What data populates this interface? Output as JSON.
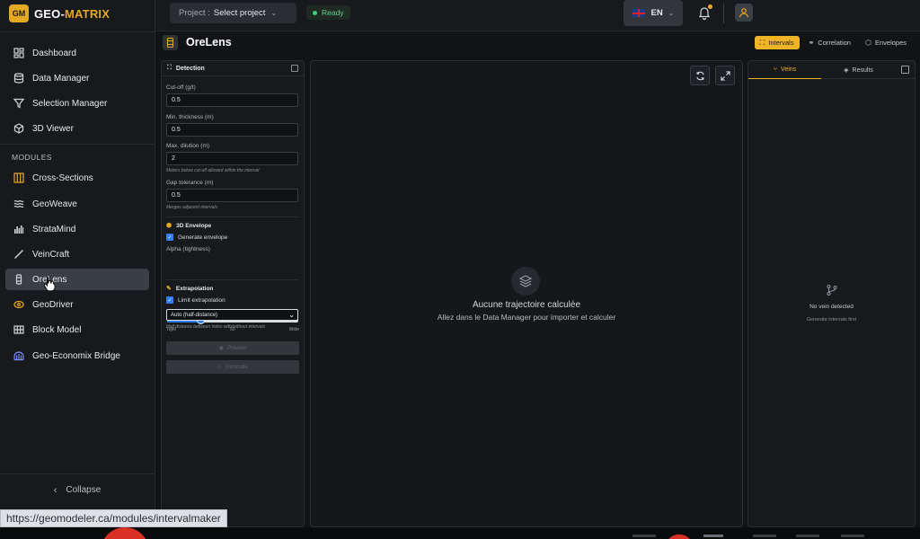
{
  "app": {
    "logo_badge": "GM",
    "logo_part1": "GEO-",
    "logo_part2": "MATRIX",
    "brand_color": "#e5a823"
  },
  "sidebar": {
    "items": [
      {
        "label": "Dashboard",
        "icon": "dashboard-icon"
      },
      {
        "label": "Data Manager",
        "icon": "database-icon"
      },
      {
        "label": "Selection Manager",
        "icon": "filter-icon"
      },
      {
        "label": "3D Viewer",
        "icon": "cube-icon"
      }
    ],
    "modules_label": "MODULES",
    "modules": [
      {
        "label": "Cross-Sections",
        "icon": "cross-sections-icon"
      },
      {
        "label": "GeoWeave",
        "icon": "waves-icon"
      },
      {
        "label": "StrataMind",
        "icon": "strata-icon"
      },
      {
        "label": "VeinCraft",
        "icon": "pen-icon"
      },
      {
        "label": "OreLens",
        "icon": "drillhole-icon",
        "active": true
      },
      {
        "label": "GeoDriver",
        "icon": "eye-icon"
      },
      {
        "label": "Block Model",
        "icon": "block-icon"
      },
      {
        "label": "Geo-Economix Bridge",
        "icon": "bridge-icon"
      }
    ],
    "collapse_label": "Collapse"
  },
  "topbar": {
    "project_label": "Project :",
    "project_value": "Select project",
    "status": "Ready",
    "language": "EN"
  },
  "page": {
    "title": "OreLens",
    "tabs": [
      {
        "label": "Intervals",
        "active": true
      },
      {
        "label": "Correlation"
      },
      {
        "label": "Envelopes"
      }
    ]
  },
  "detection": {
    "title": "Detection",
    "cutoff_label": "Cut-off (g/t)",
    "cutoff_value": "0.5",
    "min_thickness_label": "Min. thickness (m)",
    "min_thickness_value": "0.5",
    "max_dilution_label": "Max. dilution (m)",
    "max_dilution_value": "2",
    "max_dilution_hint": "Meters below cut-off allowed within the interval",
    "gap_label": "Gap tolerance (m)",
    "gap_value": "0.5",
    "gap_hint": "Merges adjacent intervals",
    "envelope_title": "3D Envelope",
    "generate_envelope_label": "Generate envelope",
    "alpha_label": "Alpha (tightness)",
    "alpha_value": 0.25,
    "alpha_min_label": "Tight",
    "alpha_mid_label": "50",
    "alpha_max_label": "Wide",
    "extrapolation_title": "Extrapolation",
    "limit_extrapolation_label": "Limit extrapolation",
    "extrapolation_mode": "Auto (half-distance)",
    "extrapolation_hint": "Half distance between holes with/without intervals",
    "preview_label": "Preview",
    "generate_label": "Generate"
  },
  "viewer": {
    "empty_title": "Aucune trajectoire calculée",
    "empty_subtitle": "Allez dans le Data Manager pour importer et calculer"
  },
  "results_panel": {
    "tabs": [
      {
        "label": "Veins",
        "active": true
      },
      {
        "label": "Results"
      }
    ],
    "empty_title": "No vein detected",
    "empty_subtitle": "Generate intervals first"
  },
  "status_url": "https://geomodeler.ca/modules/intervalmaker"
}
